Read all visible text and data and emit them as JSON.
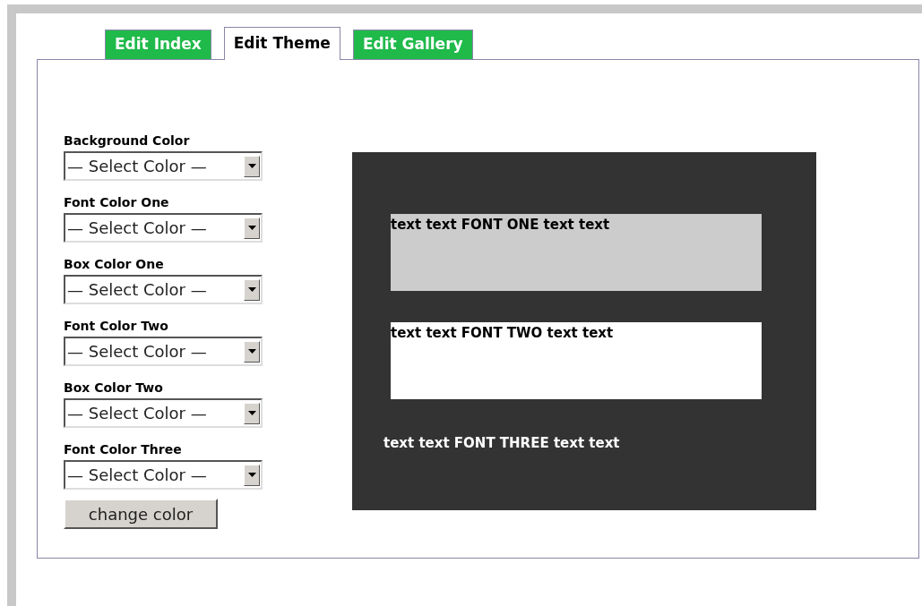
{
  "tabs": [
    {
      "label": "Edit Index",
      "selected": false
    },
    {
      "label": "Edit Theme",
      "selected": true
    },
    {
      "label": "Edit Gallery",
      "selected": false
    }
  ],
  "color_fields": [
    {
      "label": "Background Color",
      "value": "— Select Color —"
    },
    {
      "label": "Font Color One",
      "value": "— Select Color —"
    },
    {
      "label": "Box Color One",
      "value": "— Select Color —"
    },
    {
      "label": "Font Color Two",
      "value": "— Select Color —"
    },
    {
      "label": "Box Color Two",
      "value": "— Select Color —"
    },
    {
      "label": "Font Color Three",
      "value": "— Select Color —"
    }
  ],
  "submit_button": "change color",
  "preview": {
    "samples": [
      {
        "kind": "box",
        "text": "text text FONT ONE text text",
        "color": "#cccccc"
      },
      {
        "kind": "box",
        "text": "text text FONT TWO text text",
        "color": "#ffffff"
      },
      {
        "kind": "plain",
        "text": "text text FONT THREE text text",
        "color": "#ffffff"
      }
    ]
  }
}
